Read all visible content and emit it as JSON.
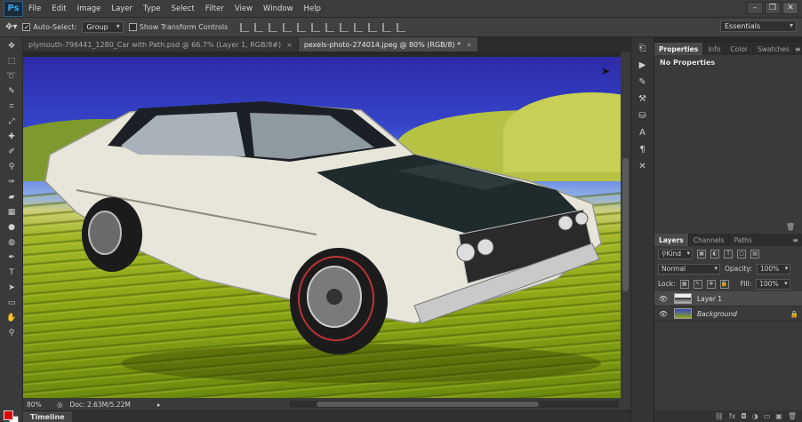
{
  "app": {
    "logo": "Ps"
  },
  "menu": [
    "File",
    "Edit",
    "Image",
    "Layer",
    "Type",
    "Select",
    "Filter",
    "View",
    "Window",
    "Help"
  ],
  "window_controls": {
    "minimize": "–",
    "restore": "❐",
    "close": "✕"
  },
  "options": {
    "auto_select_label": "Auto-Select:",
    "auto_select_checked": "✓",
    "auto_select_value": "Group",
    "transform_label": "Show Transform Controls",
    "workspace": "Essentials"
  },
  "tabs": [
    {
      "label": "plymouth-796441_1280_Car with Path.psd @ 66.7% (Layer 1, RGB/8#)",
      "close": "×"
    },
    {
      "label": "pexels-photo-274014.jpeg @ 80% (RGB/8) *",
      "close": "×"
    }
  ],
  "status": {
    "zoom": "80%",
    "doc": "Doc: 2.63M/5.22M"
  },
  "timeline": {
    "label": "Timeline"
  },
  "properties": {
    "tabs": [
      "Properties",
      "Info",
      "Color",
      "Swatches"
    ],
    "body": "No Properties"
  },
  "layers": {
    "tabs": [
      "Layers",
      "Channels",
      "Paths"
    ],
    "filter": "Kind",
    "blend_mode": "Normal",
    "opacity_label": "Opacity:",
    "opacity_value": "100%",
    "lock_label": "Lock:",
    "fill_label": "Fill:",
    "fill_value": "100%",
    "items": [
      {
        "name": "Layer 1"
      },
      {
        "name": "Background"
      }
    ]
  },
  "colors": {
    "foreground": "#e00000",
    "background": "#ffffff"
  }
}
